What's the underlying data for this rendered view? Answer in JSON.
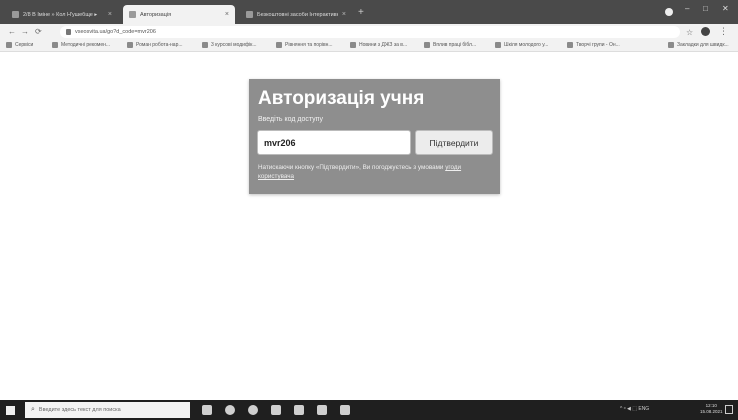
{
  "browser": {
    "tabs": [
      {
        "label": "2/8 В Іміне » Кол Н'ушебще ▸"
      },
      {
        "label": "Авторизація"
      },
      {
        "label": "Безкоштовні засоби Інтерактивно..."
      }
    ],
    "url": "vseosvita.ua/go?d_code=mvr206",
    "bookmarks": [
      {
        "label": "Сервіси"
      },
      {
        "label": "Методичні рекомен..."
      },
      {
        "label": "Роман робота-нар..."
      },
      {
        "label": "3 курсові модифік..."
      },
      {
        "label": "Рівняння та порівн..."
      },
      {
        "label": "Новини з ДЖЗ за в..."
      },
      {
        "label": "Вплив праці бібл..."
      },
      {
        "label": "Шкіля молодого у..."
      },
      {
        "label": "Творчі групи - Он..."
      },
      {
        "label": "Закладки для швидк..."
      }
    ]
  },
  "auth": {
    "title": "Авторизація учня",
    "code_label": "Введіть код доступу",
    "code_value": "mvr206",
    "confirm_label": "Підтвердити",
    "terms_text": "Натискаючи кнопку «Підтвердити», Ви погоджуєтесь з умовами ",
    "terms_link": "угоди користувача"
  },
  "taskbar": {
    "search_placeholder": "Введите здесь текст для поиска",
    "tray_text": "^ ᵒ ◀ ⬚ ENG",
    "clock_time": "12:10",
    "clock_date": "15.08.2021"
  }
}
